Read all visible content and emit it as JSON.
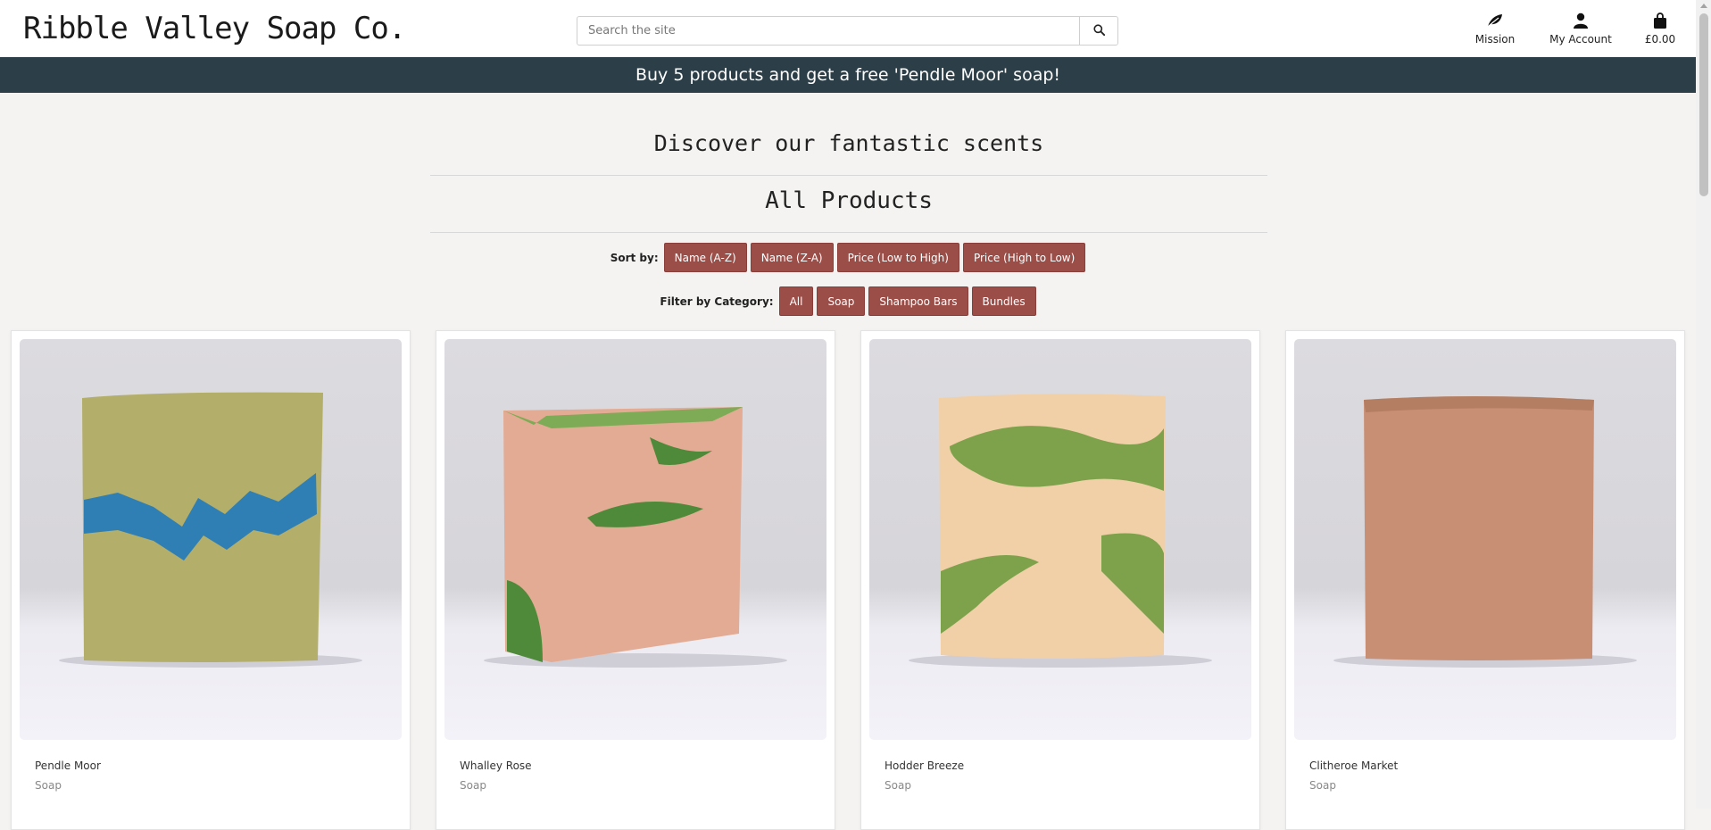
{
  "header": {
    "brand": "Ribble Valley Soap Co.",
    "search": {
      "placeholder": "Search the site",
      "value": ""
    },
    "nav": [
      {
        "label": "Mission",
        "icon": "leaf-icon"
      },
      {
        "label": "My Account",
        "icon": "user-icon"
      },
      {
        "label": "£0.00",
        "icon": "shopping-bag-icon"
      }
    ]
  },
  "banner": {
    "text": "Buy 5 products and get a free 'Pendle Moor' soap!"
  },
  "main": {
    "discover_title": "Discover our fantastic scents",
    "products_title": "All Products",
    "sort": {
      "label": "Sort by:",
      "options": [
        "Name (A-Z)",
        "Name (Z-A)",
        "Price (Low to High)",
        "Price (High to Low)"
      ]
    },
    "filter": {
      "label": "Filter by Category:",
      "options": [
        "All",
        "Soap",
        "Shampoo Bars",
        "Bundles"
      ]
    },
    "products": [
      {
        "name": "Pendle Moor",
        "category": "Soap",
        "colors": {
          "base": "#b3ae6a",
          "accent": "#2f7fb5"
        }
      },
      {
        "name": "Whalley Rose",
        "category": "Soap",
        "colors": {
          "base": "#e3ab93",
          "accent": "#4e8a3a"
        }
      },
      {
        "name": "Hodder Breeze",
        "category": "Soap",
        "colors": {
          "base": "#f1d0a8",
          "accent": "#7ea24c"
        }
      },
      {
        "name": "Clitheroe Market",
        "category": "Soap",
        "colors": {
          "base": "#c98f74",
          "accent": "#a77358"
        }
      }
    ]
  },
  "colors": {
    "banner_bg": "#2c3e48",
    "button_bg": "#9b4d48",
    "page_bg": "#f4f3f1"
  }
}
